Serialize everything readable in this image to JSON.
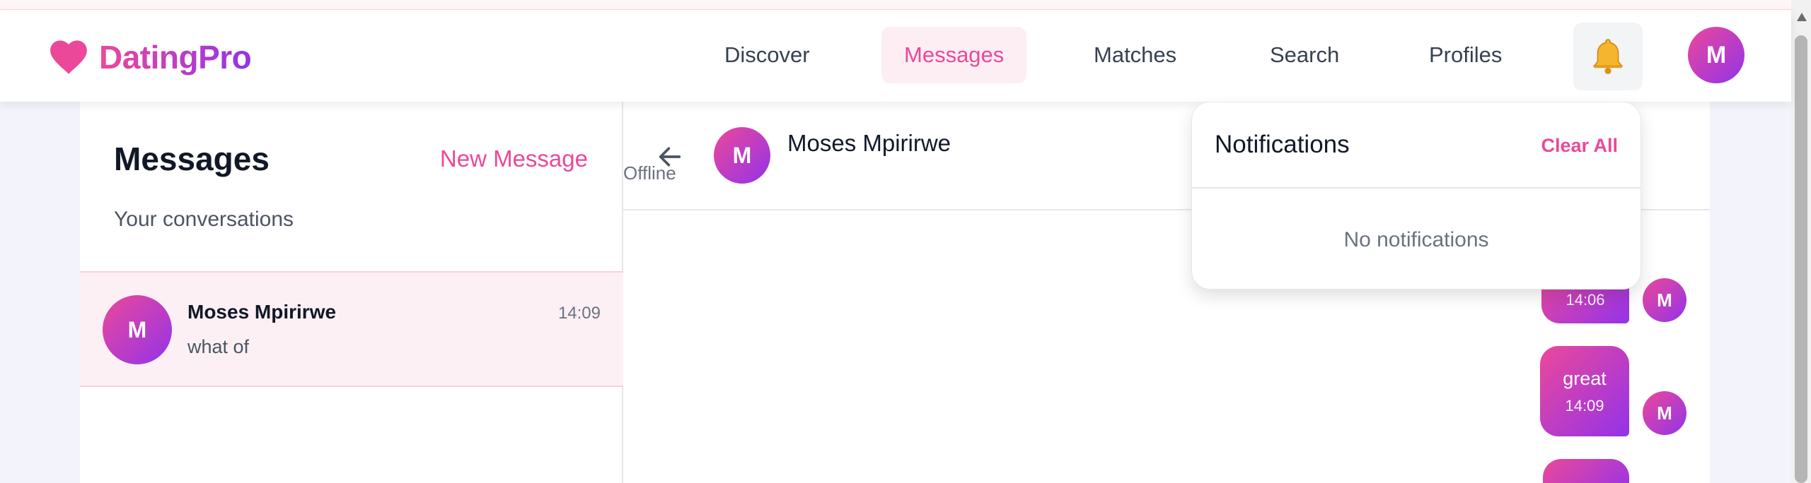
{
  "brand": {
    "name": "DatingPro",
    "accent": "#ec4899",
    "accent2": "#9333ea"
  },
  "nav": {
    "items": [
      {
        "label": "Discover",
        "active": false
      },
      {
        "label": "Messages",
        "active": true
      },
      {
        "label": "Matches",
        "active": false
      },
      {
        "label": "Search",
        "active": false
      },
      {
        "label": "Profiles",
        "active": false
      }
    ],
    "bell_icon": "bell-icon",
    "user_initial": "M"
  },
  "messages_panel": {
    "title": "Messages",
    "new_message": "New Message",
    "subtitle": "Your conversations",
    "conversations": [
      {
        "initial": "M",
        "name": "Moses Mpirirwe",
        "time": "14:09",
        "preview": "what of"
      }
    ]
  },
  "chat": {
    "back_icon": "arrow-left-icon",
    "contact": {
      "initial": "M",
      "name": "Moses Mpirirwe",
      "status": "Offline"
    },
    "messages": [
      {
        "text": "",
        "time": "14:06",
        "sender_initial": "M"
      },
      {
        "text": "great",
        "time": "14:09",
        "sender_initial": "M"
      },
      {
        "text": "",
        "time": "",
        "sender_initial": ""
      }
    ]
  },
  "notifications": {
    "title": "Notifications",
    "clear_all": "Clear All",
    "empty": "No notifications"
  }
}
